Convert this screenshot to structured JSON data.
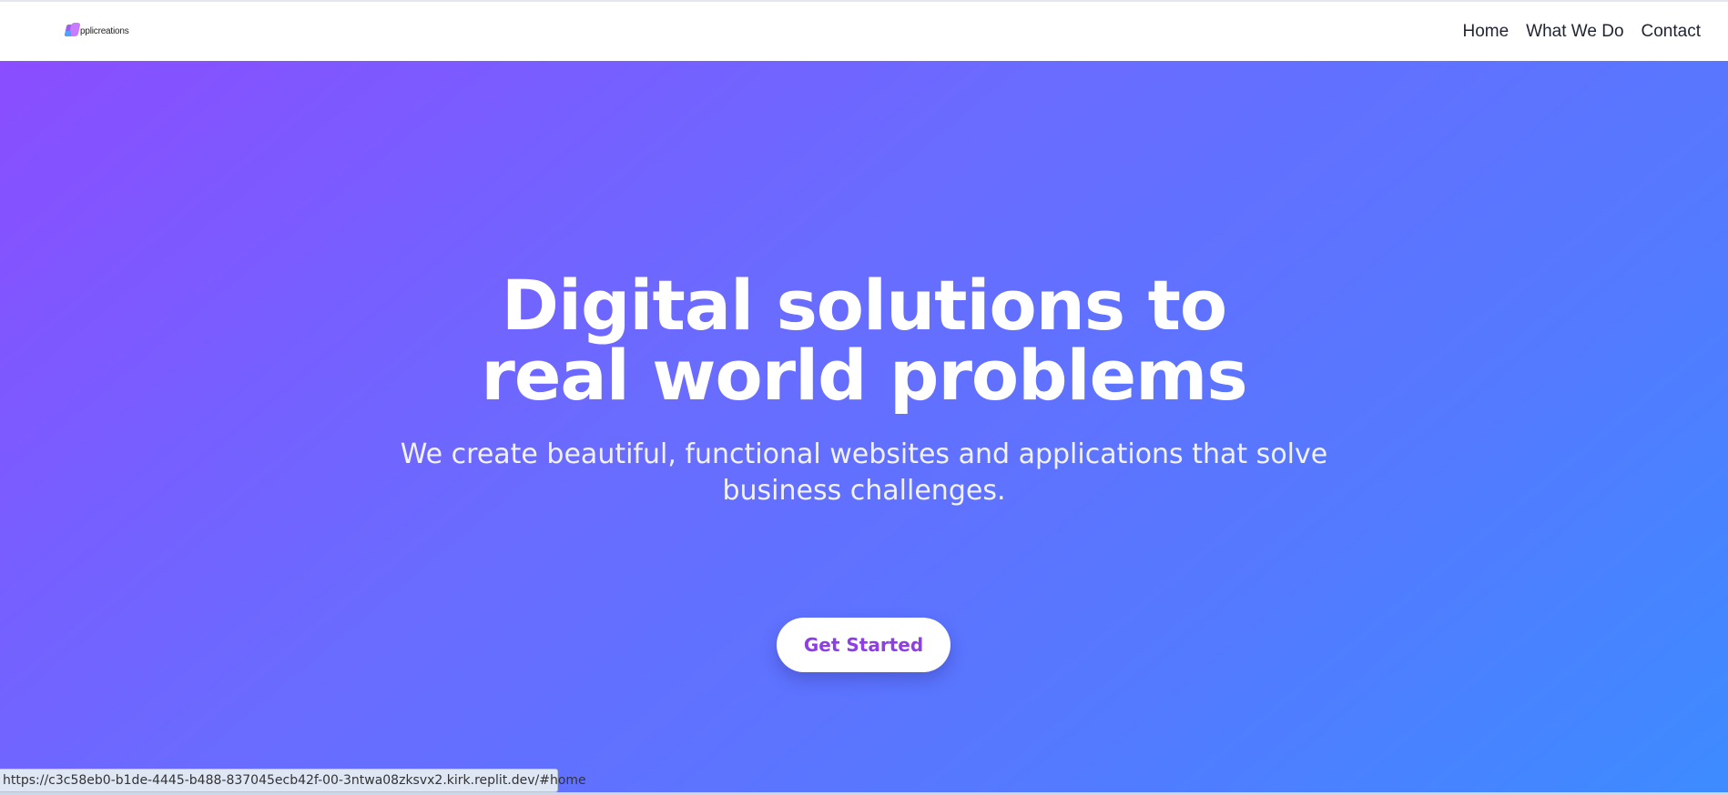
{
  "nav": {
    "logo_text": "pplicreations",
    "links": [
      {
        "label": "Home"
      },
      {
        "label": "What We Do"
      },
      {
        "label": "Contact"
      }
    ]
  },
  "hero": {
    "title_line1": "Digital solutions to",
    "title_line2": "real world problems",
    "subtitle": "We create beautiful, functional websites and applications that solve business challenges.",
    "cta_label": "Get Started"
  },
  "status_bar": {
    "url": "https://c3c58eb0-b1de-4445-b488-837045ecb42f-00-3ntwa08zksvx2.kirk.replit.dev/#home"
  },
  "colors": {
    "gradient_start": "#8a4dff",
    "gradient_end": "#3d8bff",
    "cta_text": "#8d3ee6",
    "nav_text": "#1f2430"
  }
}
